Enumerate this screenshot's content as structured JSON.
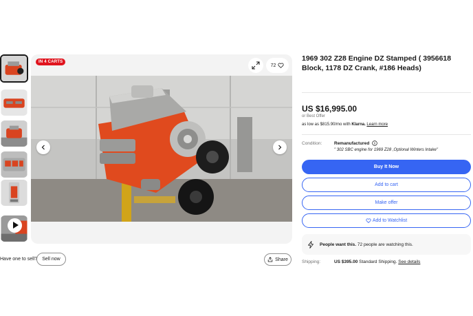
{
  "gallery": {
    "badge": "IN 4 CARTS",
    "watch_count": "72"
  },
  "left": {
    "have_one": "Have one to sell?",
    "sell_now": "Sell now",
    "share": "Share"
  },
  "listing": {
    "title": "1969 302 Z28 Engine DZ Stamped ( 3956618 Block, 1178 DZ Crank, #186 Heads)",
    "price": "US $16,995.00",
    "best_offer": "or Best Offer",
    "klarna_prefix": "as low as $815.90/mo with",
    "klarna_brand": "Klarna.",
    "klarna_link": "Learn more",
    "condition_label": "Condition:",
    "condition_value": "Remanufactured",
    "condition_desc": "\" 302 SBC engine for 1969 Z28 ,Optional Winters Intake\"",
    "buy_now": "Buy It Now",
    "add_to_cart": "Add to cart",
    "make_offer": "Make offer",
    "add_watchlist": "Add to Watchlist",
    "social_bold": "People want this.",
    "social_text": "72 people are watching this.",
    "shipping_label": "Shipping:",
    "shipping_price": "US $395.00",
    "shipping_method": "Standard Shipping.",
    "shipping_link": "See details"
  },
  "colors": {
    "accent": "#3665f3",
    "badge": "#e0141e",
    "engine": "#e04a1e"
  }
}
